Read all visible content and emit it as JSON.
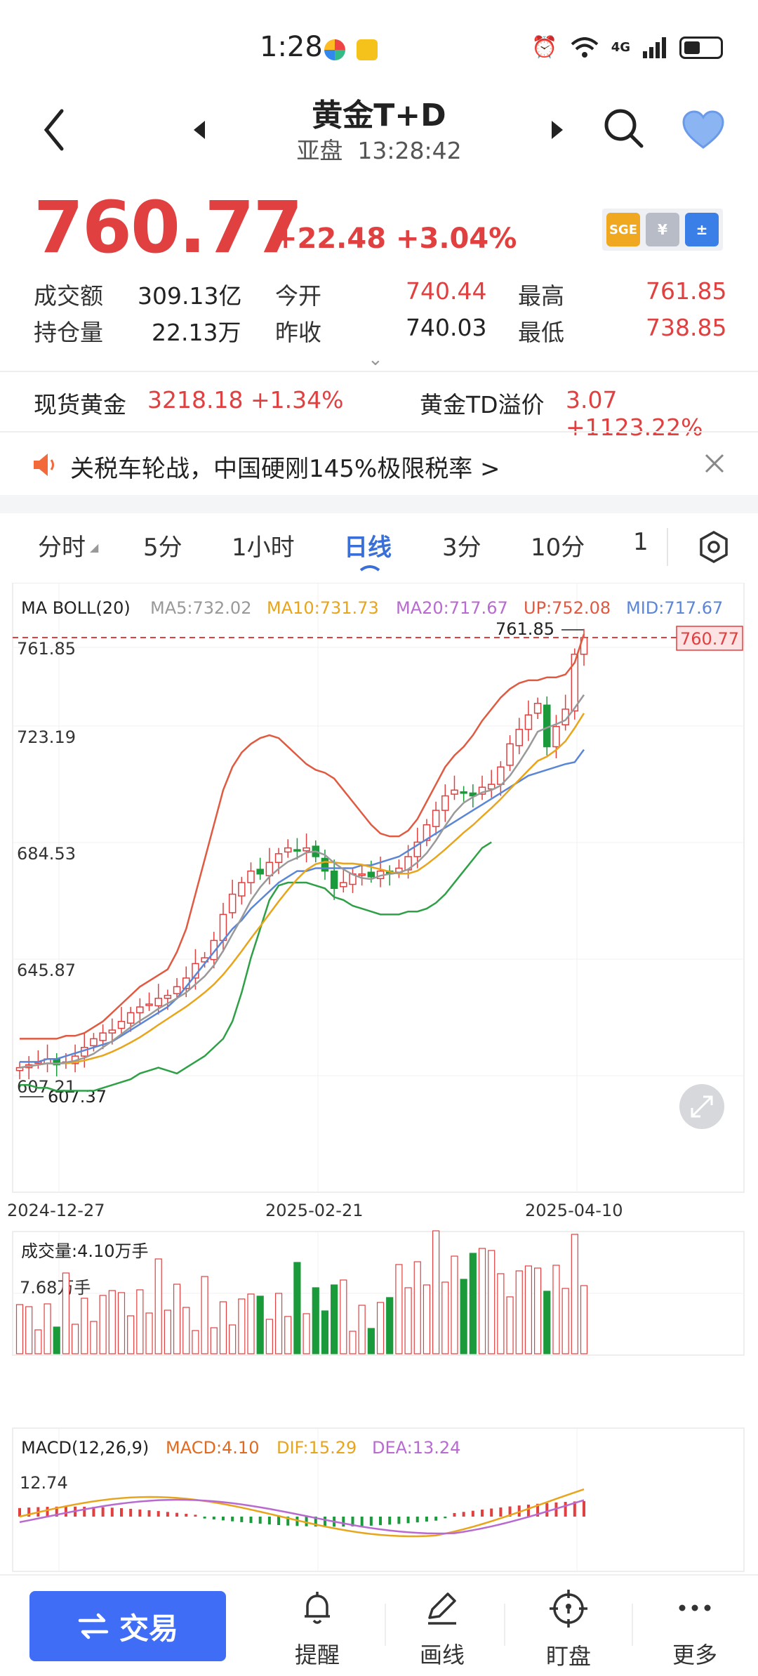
{
  "status_bar": {
    "time": "1:28",
    "network": "4G"
  },
  "header": {
    "title": "黄金T+D",
    "session": "亚盘",
    "clock": "13:28:42"
  },
  "quote": {
    "price": "760.77",
    "change": "+22.48",
    "change_pct": "+3.04%",
    "badge_sge": "SGE",
    "stats": {
      "turnover_label": "成交额",
      "turnover": "309.13亿",
      "open_label": "今开",
      "open": "740.44",
      "high_label": "最高",
      "high": "761.85",
      "oi_label": "持仓量",
      "oi": "22.13万",
      "prev_label": "昨收",
      "prev": "740.03",
      "low_label": "最低",
      "low": "738.85"
    }
  },
  "related": {
    "spot_label": "现货黄金",
    "spot_value": "3218.18 +1.34%",
    "premium_label": "黄金TD溢价",
    "premium_value": "3.07 +1123.22%"
  },
  "news": {
    "text": "关税车轮战，中国硬刚145%极限税率 >"
  },
  "tabs": [
    {
      "label": "分时"
    },
    {
      "label": "5分"
    },
    {
      "label": "1小时"
    },
    {
      "label": "日线"
    },
    {
      "label": "3分"
    },
    {
      "label": "10分"
    },
    {
      "label": "1"
    }
  ],
  "colors": {
    "up": "#e04040",
    "down": "#1a9a3a",
    "ma5": "#999999",
    "ma10": "#e8a51c",
    "ma20": "#b86ad0",
    "up_band": "#e05a42",
    "mid": "#5b86d6",
    "low_band": "#2ea046",
    "accent": "#3a6fd8"
  },
  "chart_data": [
    {
      "type": "candlestick",
      "title": "MA BOLL(20)",
      "legend": {
        "ma5": "MA5:732.02",
        "ma10": "MA10:731.73",
        "ma20": "MA20:717.67",
        "up": "UP:752.08",
        "mid": "MID:717.67"
      },
      "y_ticks": [
        "761.85",
        "723.19",
        "684.53",
        "645.87",
        "607.21"
      ],
      "ylim": [
        600,
        770
      ],
      "x_ticks": [
        "2024-12-27",
        "2025-02-21",
        "2025-04-10"
      ],
      "last_price_label": "760.77",
      "max_label": "761.85",
      "min_label": "607.37",
      "close_series": [
        612,
        613,
        614,
        615,
        613,
        614,
        616,
        619,
        622,
        624,
        625,
        628,
        631,
        633,
        634,
        636,
        637,
        640,
        643,
        648,
        650,
        656,
        665,
        672,
        676,
        680,
        679,
        683,
        686,
        688,
        687,
        688,
        685,
        680,
        674,
        676,
        679,
        679,
        678,
        680,
        679,
        681,
        685,
        690,
        696,
        701,
        706,
        708,
        707,
        706,
        709,
        710,
        716,
        724,
        729,
        734,
        738,
        723,
        730,
        736,
        755,
        760.77
      ],
      "up_band": [
        622,
        622,
        622,
        622,
        622,
        623,
        623,
        624,
        626,
        628,
        631,
        634,
        637,
        640,
        642,
        644,
        646,
        652,
        660,
        672,
        684,
        696,
        708,
        716,
        721,
        724,
        726,
        727,
        726,
        723,
        720,
        717,
        715,
        714,
        712,
        708,
        704,
        700,
        696,
        693,
        692,
        692,
        694,
        698,
        704,
        710,
        716,
        720,
        723,
        727,
        732,
        736,
        740,
        743,
        745,
        746,
        746,
        747,
        747,
        748,
        752.08,
        762
      ],
      "mid_band": [
        614,
        614,
        614,
        615,
        615,
        616,
        617,
        618,
        619,
        620,
        621,
        623,
        625,
        627,
        629,
        631,
        633,
        636,
        640,
        644,
        648,
        652,
        656,
        660,
        663,
        667,
        670,
        673,
        676,
        678,
        680,
        680,
        681,
        681,
        681,
        681,
        681,
        682,
        682,
        683,
        684,
        685,
        687,
        689,
        691,
        693,
        695,
        697,
        699,
        701,
        703,
        705,
        707,
        709,
        711,
        713,
        714,
        715,
        716,
        717,
        717.67,
        722
      ],
      "low_band": [
        606,
        606,
        605,
        605,
        604,
        604,
        604,
        604,
        604,
        605,
        606,
        607,
        608,
        610,
        611,
        612,
        611,
        610,
        612,
        614,
        616,
        619,
        622,
        628,
        638,
        650,
        660,
        670,
        675,
        676,
        676,
        676,
        675,
        674,
        671,
        670,
        668,
        667,
        666,
        665,
        665,
        665,
        666,
        666,
        667,
        669,
        672,
        676,
        680,
        684,
        688,
        690
      ]
    },
    {
      "type": "bar",
      "title": "成交量:4.10万手",
      "y_ticks": [
        "7.68万手"
      ]
    },
    {
      "type": "macd",
      "title": "MACD(12,26,9)",
      "legend": {
        "macd": "MACD:4.10",
        "dif": "DIF:15.29",
        "dea": "DEA:13.24"
      },
      "y_ticks": [
        "12.74"
      ]
    }
  ],
  "bottom_bar": {
    "trade": "交易",
    "alert": "提醒",
    "draw": "画线",
    "watch": "盯盘",
    "more": "更多"
  }
}
